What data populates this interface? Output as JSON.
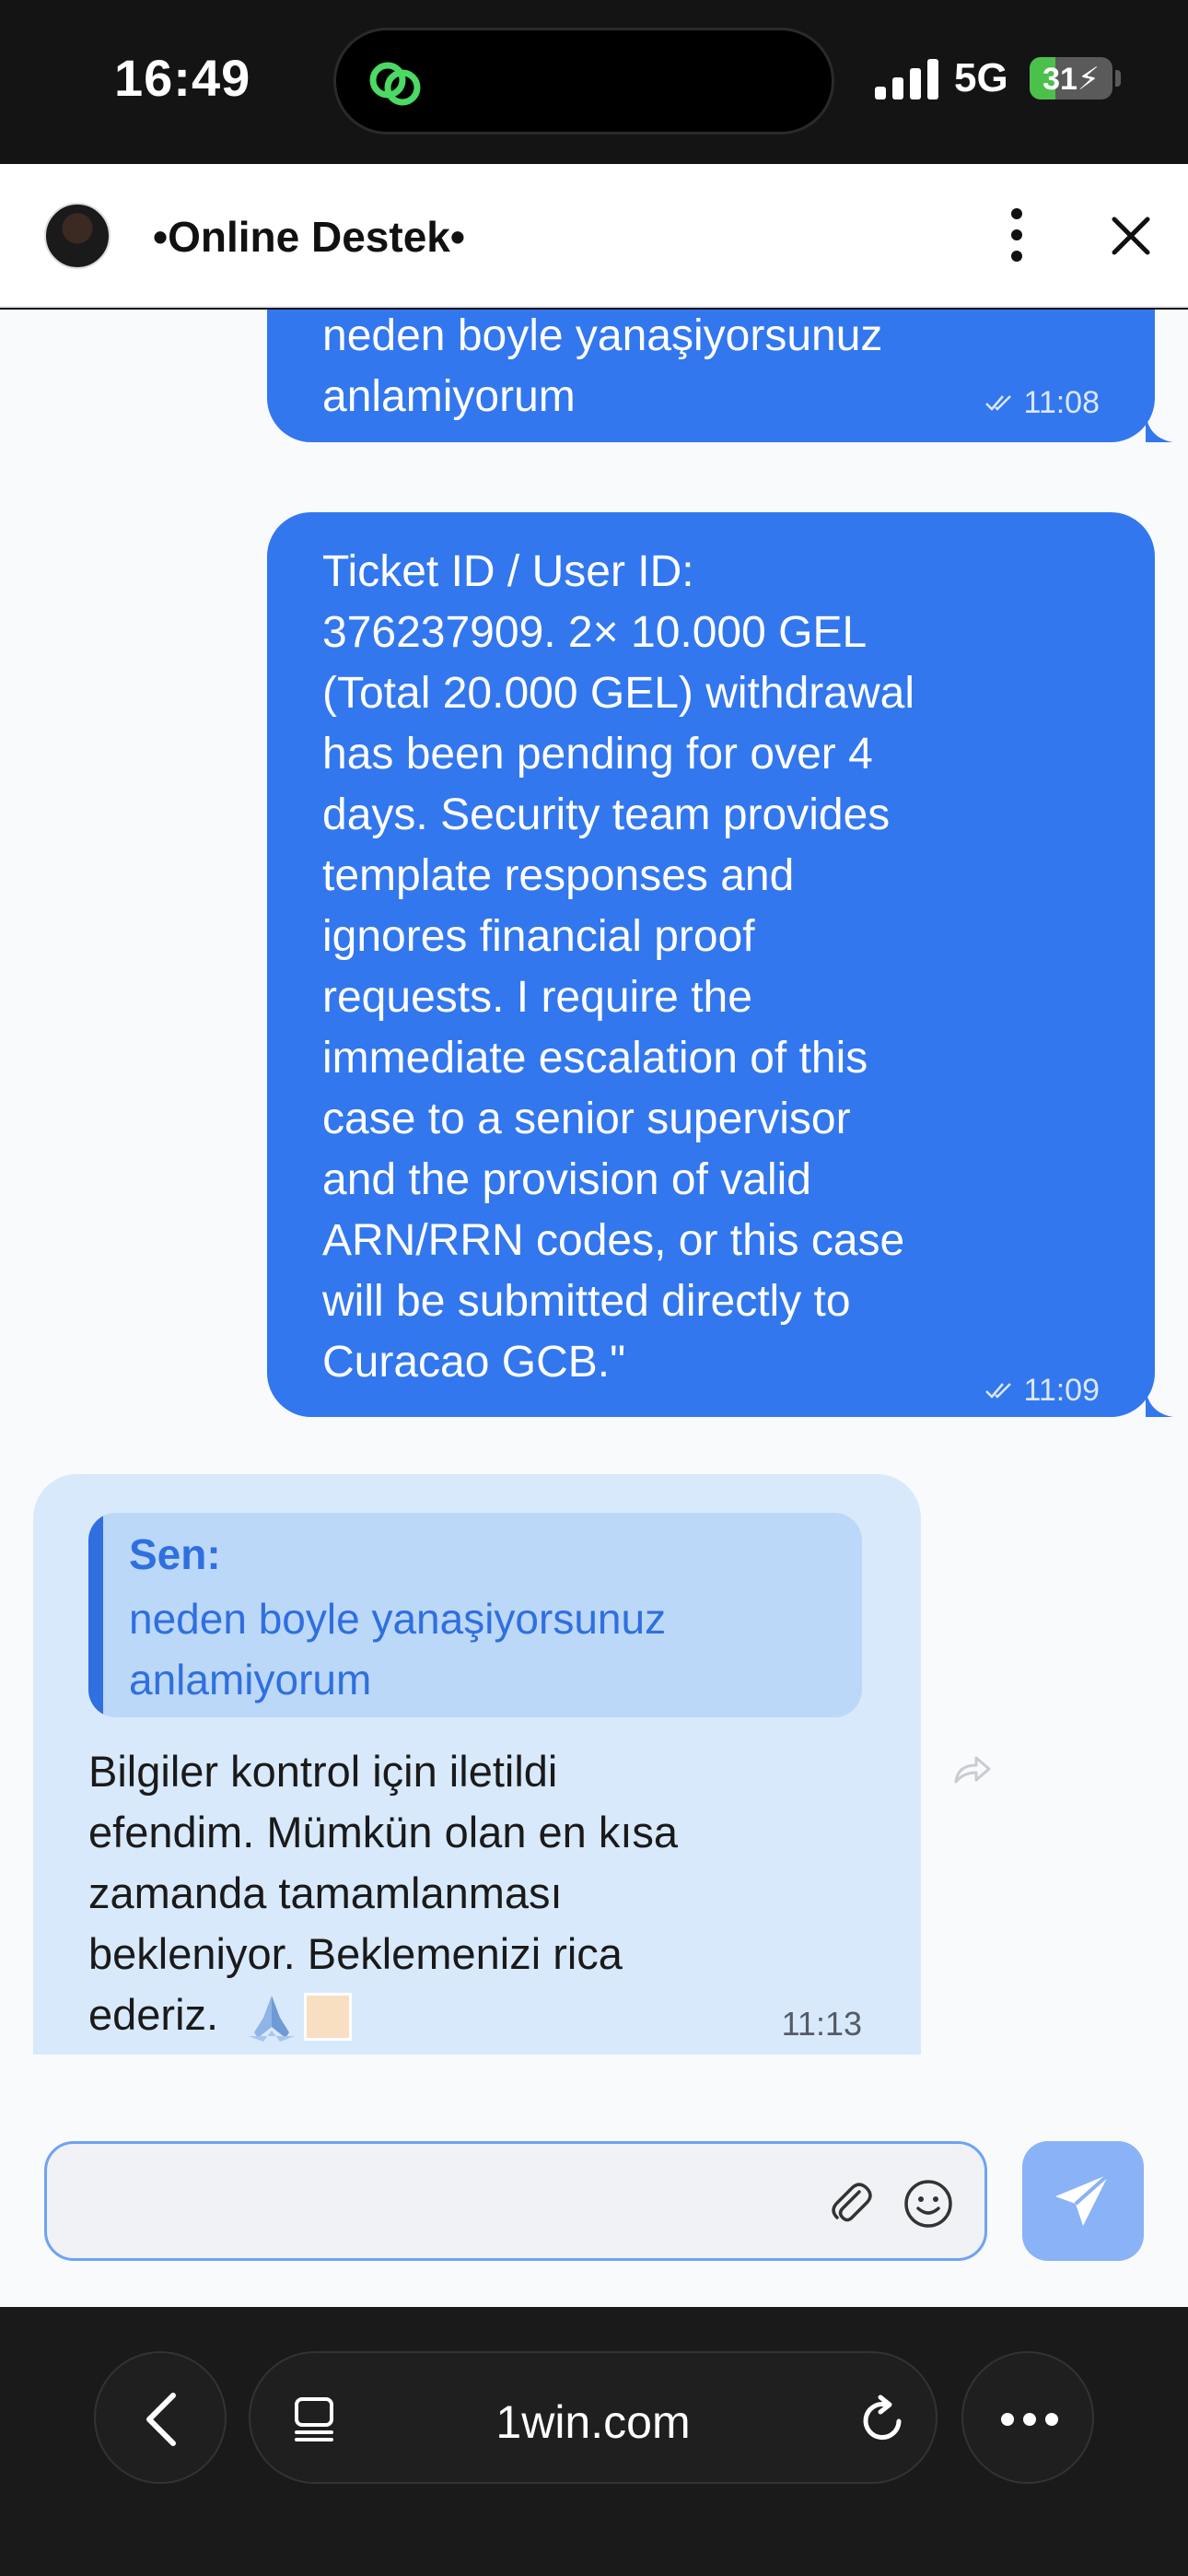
{
  "status_bar": {
    "time": "16:49",
    "network": "5G",
    "battery": "31",
    "battery_level": 0.31,
    "island_icon": "link-app-icon",
    "accent_color": "#4cc04a"
  },
  "header": {
    "title": "•Online Destek•",
    "menu_icon": "more-vertical-icon",
    "close_icon": "close-icon"
  },
  "messages": [
    {
      "direction": "outgoing",
      "text": "neden boyle yanaşiyorsunuz\nanlamiyorum",
      "time": "11:08",
      "status_icon": "double-check-icon"
    },
    {
      "direction": "outgoing",
      "text": "Ticket ID / User ID:\n376237909. 2× 10.000 GEL\n(Total 20.000 GEL) withdrawal\nhas been pending for over 4\ndays. Security team provides\ntemplate responses and\nignores financial proof\nrequests. I require the\nimmediate escalation of this\ncase to a senior supervisor\nand the provision of valid\nARN/RRN codes, or this case\nwill be submitted directly to\nCuracao GCB.\"",
      "time": "11:09",
      "status_icon": "double-check-icon"
    },
    {
      "direction": "incoming",
      "quote_author": "Sen:",
      "quote_text": "neden boyle yanaşiyorsunuz\nanlamiyorum",
      "text": "Bilgiler kontrol için iletildi\nefendim. Mümkün olan en kısa\nzamanda tamamlanması\nbekleniyor. Beklemenizi rica\nederiz.",
      "emoji": "pray-hands-icon",
      "time": "11:13"
    }
  ],
  "composer": {
    "placeholder": "",
    "value": "",
    "attach_icon": "paperclip-icon",
    "emoji_icon": "smiley-icon",
    "send_icon": "send-icon"
  },
  "browser": {
    "url": "1win.com",
    "back_icon": "back-icon",
    "tabs_icon": "tab-list-icon",
    "reload_icon": "reload-icon",
    "more_icon": "more-horizontal-icon"
  },
  "colors": {
    "outgoing_bubble": "#3277ee",
    "incoming_bubble": "#d8e9fb",
    "quote_accent": "#2f6fe0",
    "send_button": "#8ab2f6"
  }
}
